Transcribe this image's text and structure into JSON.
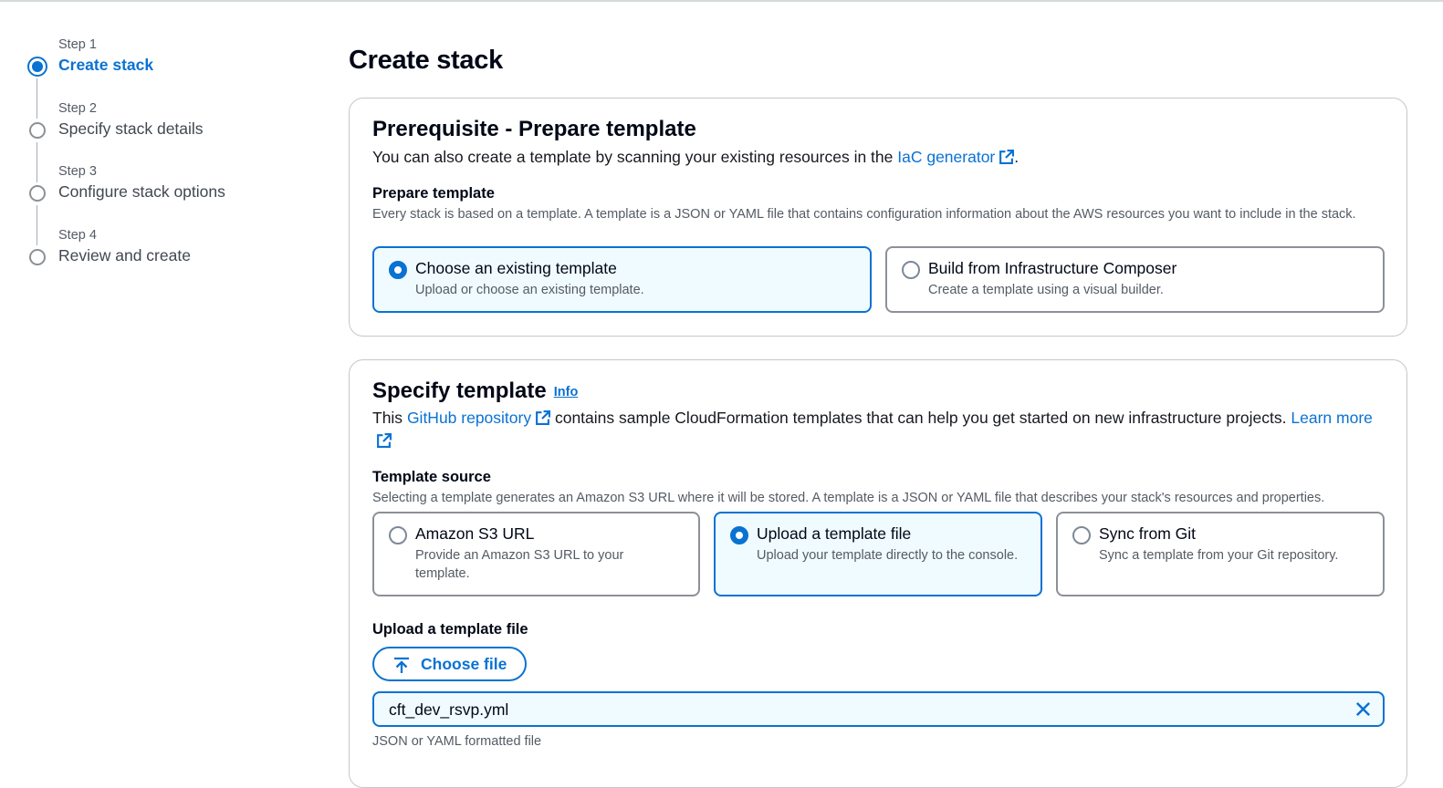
{
  "steps": [
    {
      "num": "Step 1",
      "label": "Create stack",
      "active": true
    },
    {
      "num": "Step 2",
      "label": "Specify stack details",
      "active": false
    },
    {
      "num": "Step 3",
      "label": "Configure stack options",
      "active": false
    },
    {
      "num": "Step 4",
      "label": "Review and create",
      "active": false
    }
  ],
  "page_title": "Create stack",
  "prerequisite": {
    "title": "Prerequisite - Prepare template",
    "desc_before": "You can also create a template by scanning your existing resources in the ",
    "desc_link": "IaC generator",
    "desc_after": ".",
    "field_label": "Prepare template",
    "field_desc": "Every stack is based on a template. A template is a JSON or YAML file that contains configuration information about the AWS resources you want to include in the stack.",
    "options": [
      {
        "title": "Choose an existing template",
        "desc": "Upload or choose an existing template.",
        "selected": true
      },
      {
        "title": "Build from Infrastructure Composer",
        "desc": "Create a template using a visual builder.",
        "selected": false
      }
    ]
  },
  "specify": {
    "title": "Specify template",
    "info": "Info",
    "desc_1": "This ",
    "desc_link_1": "GitHub repository",
    "desc_2": " contains sample CloudFormation templates that can help you get started on new infrastructure projects. ",
    "desc_link_2a": "Learn",
    "desc_link_2b": "more",
    "field_label": "Template source",
    "field_desc": "Selecting a template generates an Amazon S3 URL where it will be stored. A template is a JSON or YAML file that describes your stack's resources and properties.",
    "options": [
      {
        "title": "Amazon S3 URL",
        "desc": "Provide an Amazon S3 URL to your template.",
        "selected": false
      },
      {
        "title": "Upload a template file",
        "desc": "Upload your template directly to the console.",
        "selected": true
      },
      {
        "title": "Sync from Git",
        "desc": "Sync a template from your Git repository.",
        "selected": false
      }
    ],
    "upload_label": "Upload a template file",
    "choose_file": "Choose file",
    "file_name": "cft_dev_rsvp.yml",
    "file_hint": "JSON or YAML formatted file"
  },
  "colors": {
    "accent": "#0972d3",
    "selected_bg": "#f0fbff",
    "border": "#8c9097"
  }
}
